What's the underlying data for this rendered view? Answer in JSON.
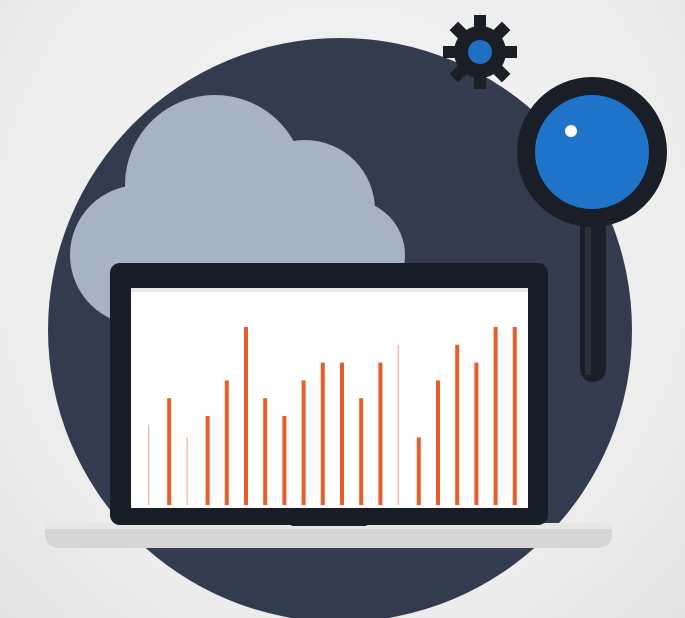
{
  "illustration": {
    "subject": "cloud analytics",
    "elements": [
      "circle-backdrop",
      "cloud",
      "gear",
      "magnifying-glass",
      "laptop",
      "bar-chart"
    ]
  },
  "colors": {
    "background": "#ececec",
    "circle": "#333c4e",
    "cloud": "#a7b3c5",
    "gear": "#1b1e24",
    "gear_center": "#1d6fc4",
    "lens_ring": "#1a1f27",
    "lens_glass": "#1f73c8",
    "laptop_frame": "#171e26",
    "screen": "#ffffff",
    "bar": "#e85d2a",
    "bar_faint": "#f3c2ae",
    "laptop_base": "#d9d9d9"
  },
  "chart_data": {
    "type": "bar",
    "values": [
      0.45,
      0.6,
      0.38,
      0.5,
      0.7,
      1.0,
      0.6,
      0.5,
      0.7,
      0.8,
      0.8,
      0.6,
      0.8,
      0.9,
      0.38,
      0.7,
      0.9,
      0.8,
      1.0,
      1.0
    ],
    "faint": [
      true,
      false,
      true,
      false,
      false,
      false,
      false,
      false,
      false,
      false,
      false,
      false,
      false,
      true,
      false,
      false,
      false,
      false,
      false,
      false
    ],
    "ylim": [
      0,
      1
    ]
  }
}
